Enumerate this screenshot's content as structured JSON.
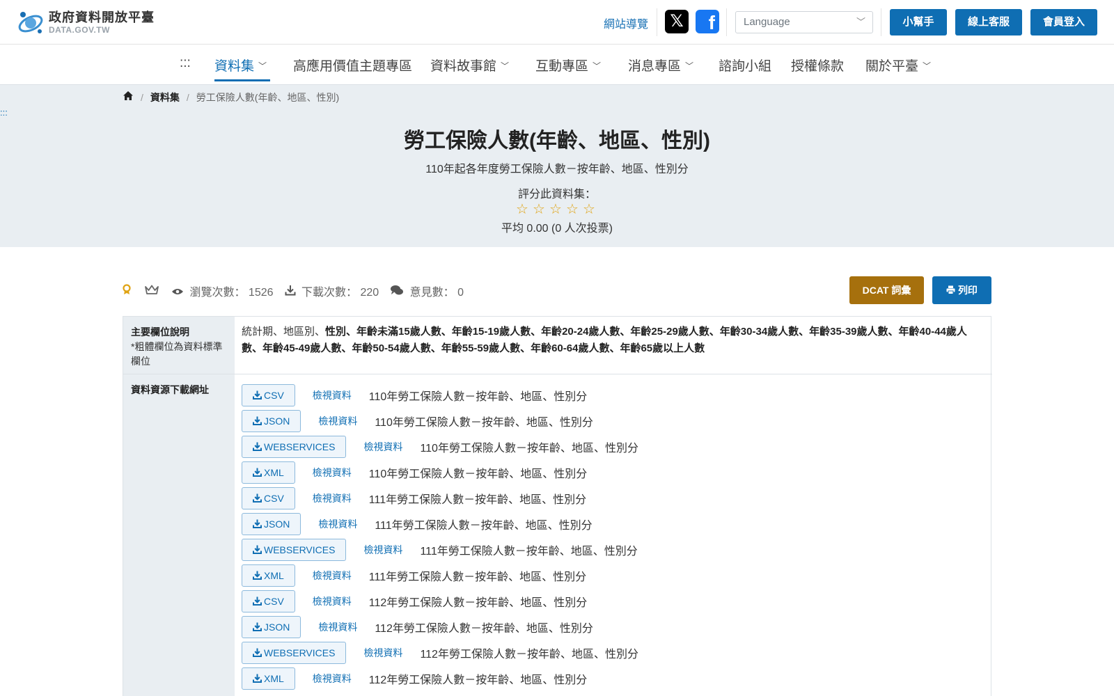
{
  "header": {
    "logo_name": "政府資料開放平臺",
    "logo_sub": "DATA.GOV.TW",
    "site_guide": "網站導覽",
    "social_x_icon": "x-twitter-icon",
    "social_fb_icon": "facebook-icon",
    "language_placeholder": "Language",
    "help_button": "小幫手",
    "support_button": "線上客服",
    "login_button": "會員登入"
  },
  "nav": {
    "accesskey": ":::",
    "items": [
      {
        "label": "資料集",
        "dropdown": true,
        "active": true
      },
      {
        "label": "高應用價值主題專區",
        "dropdown": false
      },
      {
        "label": "資料故事館",
        "dropdown": true
      },
      {
        "label": "互動專區",
        "dropdown": true
      },
      {
        "label": "消息專區",
        "dropdown": true
      },
      {
        "label": "諮詢小組",
        "dropdown": false
      },
      {
        "label": "授權條款",
        "dropdown": false
      },
      {
        "label": "關於平臺",
        "dropdown": true
      }
    ]
  },
  "breadcrumb": {
    "home_icon": "home-icon",
    "sep": "/",
    "datasets": "資料集",
    "current": "勞工保險人數(年齡、地區、性別)"
  },
  "hero": {
    "accesskey": ":::",
    "title": "勞工保險人數(年齡、地區、性別)",
    "subtitle": "110年起各年度勞工保險人數－按年齡、地區、性別分",
    "rate_label": "評分此資料集：",
    "star_glyph": "☆",
    "average": "平均 0.00 (0 人次投票)"
  },
  "stats": {
    "views_label": "瀏覽次數：",
    "views": "1526",
    "downloads_label": "下載次數：",
    "downloads": "220",
    "comments_label": "意見數：",
    "comments": "0"
  },
  "actions": {
    "dcat": "DCAT 詞彙",
    "print": "列印"
  },
  "table": {
    "fields_label": "主要欄位說明",
    "fields_note": "*粗體欄位為資料標準欄位",
    "fields_plain": "統計期、地區別、",
    "fields_bold": "性別、年齡未滿15歲人數、年齡15-19歲人數、年齡20-24歲人數、年齡25-29歲人數、年齡30-34歲人數、年齡35-39歲人數、年齡40-44歲人數、年齡45-49歲人數、年齡50-54歲人數、年齡55-59歲人數、年齡60-64歲人數、年齡65歲以上人數",
    "download_label": "資料資源下載網址",
    "view_label": "檢視資料",
    "resources": [
      {
        "format": "CSV",
        "name": "110年勞工保險人數－按年齡、地區、性別分"
      },
      {
        "format": "JSON",
        "name": "110年勞工保險人數－按年齡、地區、性別分"
      },
      {
        "format": "WEBSERVICES",
        "name": "110年勞工保險人數－按年齡、地區、性別分"
      },
      {
        "format": "XML",
        "name": "110年勞工保險人數－按年齡、地區、性別分"
      },
      {
        "format": "CSV",
        "name": "111年勞工保險人數－按年齡、地區、性別分"
      },
      {
        "format": "JSON",
        "name": "111年勞工保險人數－按年齡、地區、性別分"
      },
      {
        "format": "WEBSERVICES",
        "name": "111年勞工保險人數－按年齡、地區、性別分"
      },
      {
        "format": "XML",
        "name": "111年勞工保險人數－按年齡、地區、性別分"
      },
      {
        "format": "CSV",
        "name": "112年勞工保險人數－按年齡、地區、性別分"
      },
      {
        "format": "JSON",
        "name": "112年勞工保險人數－按年齡、地區、性別分"
      },
      {
        "format": "WEBSERVICES",
        "name": "112年勞工保險人數－按年齡、地區、性別分"
      },
      {
        "format": "XML",
        "name": "112年勞工保險人數－按年齡、地區、性別分"
      }
    ]
  },
  "colors": {
    "primary": "#0f6eb3",
    "dcat": "#a6700d",
    "star": "#e0a415",
    "hero_bg": "#e9eef2"
  }
}
